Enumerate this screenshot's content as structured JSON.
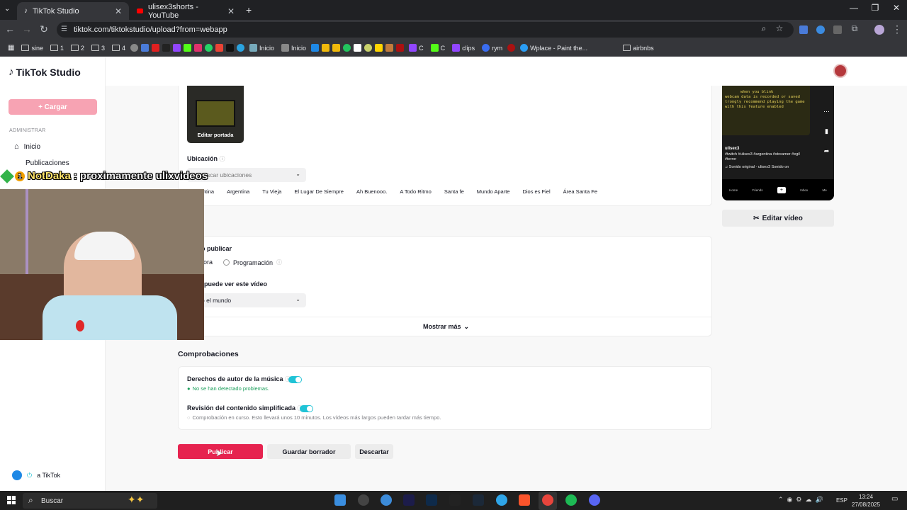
{
  "browser": {
    "tabs": [
      {
        "title": "TikTok Studio",
        "active": true
      },
      {
        "title": "ulisex3shorts - YouTube",
        "active": false
      }
    ],
    "new_tab": "+",
    "url": "tiktok.com/tiktokstudio/upload?from=webapp",
    "bookmarks": [
      "sine",
      "1",
      "2",
      "3",
      "4",
      "Inicio",
      "Inicio",
      "C",
      "C",
      "clips",
      "rym",
      "Wplace - Paint the...",
      "airbnbs"
    ]
  },
  "sidebar": {
    "logo": "TikTok Studio",
    "upload_label": "+ Cargar",
    "section": "ADMINISTRAR",
    "items": [
      "Inicio",
      "Publicaciones"
    ],
    "footer": "a TikTok"
  },
  "editor": {
    "cover_label": "Editar portada",
    "location_label": "Ubicación",
    "location_placeholder": "scar ubicaciones",
    "location_chips": [
      "Argentina",
      "Argentina",
      "Tu Vieja",
      "El Lugar De Siempre",
      "Ah Buenooo.",
      "A Todo Ritmo",
      "Santa fe",
      "Mundo Aparte",
      "Dios es Fiel",
      "Área Santa Fe"
    ],
    "when_label": "o publicar",
    "when_now": "ora",
    "when_schedule": "Programación",
    "who_label": "puede ver este vídeo",
    "who_value": "o el mundo",
    "show_more": "Mostrar más"
  },
  "checks": {
    "title": "Comprobaciones",
    "music_label": "Derechos de autor de la música",
    "music_status": "No se han detectado problemas.",
    "content_label": "Revisión del contenido simplificada",
    "content_status": "Comprobación en curso. Esto llevará unos 10 minutos. Los vídeos más largos pueden tardar más tiempo."
  },
  "actions": {
    "publish": "Publicar",
    "draft": "Guardar borrador",
    "discard": "Descartar"
  },
  "preview": {
    "edit_video": "Editar vídeo",
    "screen_lines": [
      "when you blink",
      "webcam data is recorded or saved",
      "trongly recommend playing the game",
      "with this feature enabled"
    ],
    "username": "ulisex3",
    "hashtags": "#twitch #ulisex3 #argentina #streamer #egil #terror",
    "sound": "Sonido original - ulisex3   Sonido on",
    "nav": [
      "Home",
      "Friends",
      "+",
      "Inbox",
      "Me"
    ]
  },
  "overlay": {
    "user": "NotDaka",
    "message": ": proximamente ulixvideos",
    "badge": "1"
  },
  "taskbar": {
    "search": "Buscar",
    "lang": "ESP",
    "time": "13:24",
    "date": "27/08/2025"
  },
  "colors": {
    "accent": "#fe2c55",
    "toggle": "#20c3d6",
    "success": "#1a9e5a"
  }
}
